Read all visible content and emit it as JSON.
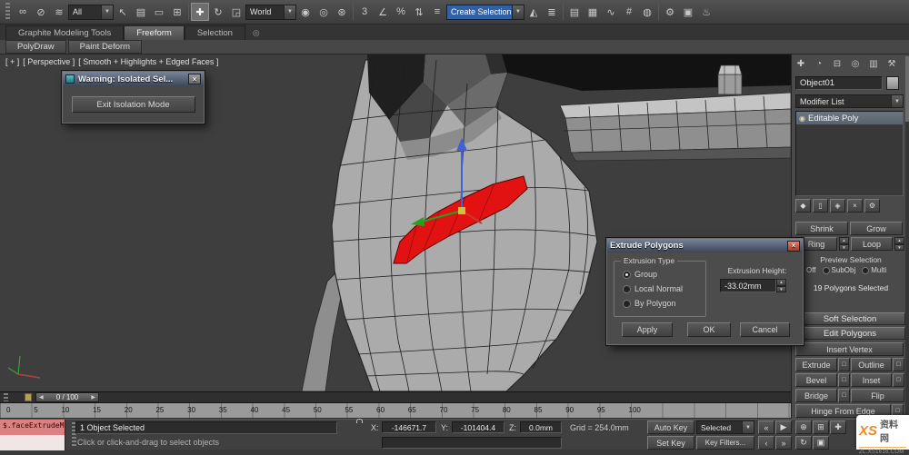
{
  "ui": {
    "dropdown_arrow": "▼",
    "spinner_up": "▲",
    "spinner_down": "▼",
    "close_glyph": "×",
    "ribbon_circle": "◎",
    "bulb_glyph": "◉"
  },
  "toolbar": {
    "filter_value": "All",
    "coord_value": "World",
    "named_sel_value": "Create Selection Se",
    "icons": [
      {
        "name": "select-and-link-icon",
        "glyph": "∞"
      },
      {
        "name": "unlink-selection-icon",
        "glyph": "⊘"
      },
      {
        "name": "bind-to-space-warp-icon",
        "glyph": "≋"
      },
      {
        "name": "select-object-icon",
        "glyph": "↖"
      },
      {
        "name": "select-by-name-icon",
        "glyph": "▤"
      },
      {
        "name": "rectangular-selection-region-icon",
        "glyph": "▭"
      },
      {
        "name": "window-crossing-icon",
        "glyph": "⊞"
      },
      {
        "name": "select-and-move-icon",
        "glyph": "✚"
      },
      {
        "name": "select-and-rotate-icon",
        "glyph": "↻"
      },
      {
        "name": "select-and-scale-icon",
        "glyph": "◲"
      },
      {
        "name": "use-pivot-point-center-icon",
        "glyph": "◉"
      },
      {
        "name": "select-and-manipulate-icon",
        "glyph": "◎"
      },
      {
        "name": "keyboard-shortcut-override-icon",
        "glyph": "⊛"
      },
      {
        "name": "snaps-toggle-icon",
        "glyph": "3"
      },
      {
        "name": "angle-snap-icon",
        "glyph": "∠"
      },
      {
        "name": "percent-snap-icon",
        "glyph": "%"
      },
      {
        "name": "spinner-snap-icon",
        "glyph": "⇅"
      },
      {
        "name": "edit-named-selection-sets-icon",
        "glyph": "≡"
      },
      {
        "name": "mirror-icon",
        "glyph": "◭"
      },
      {
        "name": "align-icon",
        "glyph": "≣"
      },
      {
        "name": "layer-manager-icon",
        "glyph": "▤"
      },
      {
        "name": "graphite-ribbon-toggle-icon",
        "glyph": "▦"
      },
      {
        "name": "curve-editor-icon",
        "glyph": "∿"
      },
      {
        "name": "schematic-view-icon",
        "glyph": "#"
      },
      {
        "name": "material-editor-icon",
        "glyph": "◍"
      },
      {
        "name": "render-setup-icon",
        "glyph": "⚙"
      },
      {
        "name": "rendered-frame-window-icon",
        "glyph": "▣"
      },
      {
        "name": "render-production-icon",
        "glyph": "♨"
      }
    ]
  },
  "ribbon": {
    "tab_graphite": "Graphite Modeling Tools",
    "tab_freeform": "Freeform",
    "tab_selection": "Selection",
    "subtab_polydraw": "PolyDraw",
    "subtab_paint": "Paint Deform"
  },
  "viewport": {
    "label_plus": "[ + ]",
    "label_view": "[ Perspective ]",
    "label_shading": "[ Smooth + Highlights + Edged Faces ]"
  },
  "warning_dialog": {
    "title": "Warning: Isolated Sel...",
    "button_label": "Exit Isolation Mode"
  },
  "extrude_dialog": {
    "title": "Extrude Polygons",
    "group_label": "Extrusion Type",
    "radios": [
      "Group",
      "Local Normal",
      "By Polygon"
    ],
    "selected_radio": "Group",
    "height_label": "Extrusion Height:",
    "height_value": "-33.02mm",
    "apply_label": "Apply",
    "ok_label": "OK",
    "cancel_label": "Cancel"
  },
  "command_panel": {
    "tabs": [
      {
        "name": "create-tab-icon",
        "glyph": "✚"
      },
      {
        "name": "modify-tab-icon",
        "glyph": "◔"
      },
      {
        "name": "hierarchy-tab-icon",
        "glyph": "⊟"
      },
      {
        "name": "motion-tab-icon",
        "glyph": "◎"
      },
      {
        "name": "display-tab-icon",
        "glyph": "▥"
      },
      {
        "name": "utilities-tab-icon",
        "glyph": "⚒"
      }
    ],
    "object_name": "Object01",
    "modifier_list_label": "Modifier List",
    "stack_item": "Editable Poly",
    "stack_tools": [
      {
        "name": "pin-stack-icon",
        "glyph": "◆"
      },
      {
        "name": "show-end-result-icon",
        "glyph": "▯"
      },
      {
        "name": "make-unique-icon",
        "glyph": "◈"
      },
      {
        "name": "remove-modifier-icon",
        "glyph": "×"
      },
      {
        "name": "configure-modifier-sets-icon",
        "glyph": "⚙"
      }
    ],
    "selection": {
      "shrink": "Shrink",
      "grow": "Grow",
      "ring": "Ring",
      "loop": "Loop",
      "preview_label": "Preview Selection",
      "preview_off": "Off",
      "preview_subobj": "SubObj",
      "preview_multi": "Multi",
      "status": "19 Polygons Selected"
    },
    "rollout_soft_selection": "Soft Selection",
    "rollout_edit_polygons": "Edit Polygons",
    "edit": {
      "insert_vertex": "Insert Vertex",
      "extrude": "Extrude",
      "outline": "Outline",
      "bevel": "Bevel",
      "inset": "Inset",
      "bridge": "Bridge",
      "flip": "Flip",
      "hinge": "Hinge From Edge"
    }
  },
  "timeline": {
    "slider_label": "0 / 100",
    "prev_glyph": "◀",
    "next_glyph": "▶",
    "ticks": [
      "0",
      "5",
      "10",
      "15",
      "20",
      "25",
      "30",
      "35",
      "40",
      "45",
      "50",
      "55",
      "60",
      "65",
      "70",
      "75",
      "80",
      "85",
      "90",
      "95",
      "100"
    ]
  },
  "status_bar": {
    "listener_text": "$.faceExtrudeM",
    "prompt": "1 Object Selected",
    "hint": "Click or click-and-drag to select objects",
    "x_label": "X:",
    "x_value": "-146671.7",
    "y_label": "Y:",
    "y_value": "-101404.4",
    "z_label": "Z:",
    "z_value": "0.0mm",
    "grid_label": "Grid = 254.0mm",
    "auto_key": "Auto Key",
    "set_key": "Set Key",
    "selection_combo": "Selected",
    "key_filters": "Key Filters...",
    "playback": [
      {
        "name": "go-to-start-button",
        "glyph": "«"
      },
      {
        "name": "play-button",
        "glyph": "▶"
      },
      {
        "name": "previous-key-button",
        "glyph": "‹"
      },
      {
        "name": "go-to-end-button",
        "glyph": "»"
      }
    ],
    "nav": [
      {
        "name": "zoom-icon",
        "glyph": "⊕"
      },
      {
        "name": "zoom-extents-icon",
        "glyph": "⊞"
      },
      {
        "name": "pan-icon",
        "glyph": "✚"
      },
      {
        "name": "orbit-icon",
        "glyph": "↻"
      },
      {
        "name": "maximize-viewport-icon",
        "glyph": "▣"
      }
    ]
  },
  "watermark": {
    "logo": "XS",
    "brand": "资料网",
    "url": "ZL.XS1616.COM"
  },
  "colors": {
    "selection_red": "#e31212",
    "combo_highlight": "#3161a3",
    "watermark_orange": "#f08a1d"
  }
}
